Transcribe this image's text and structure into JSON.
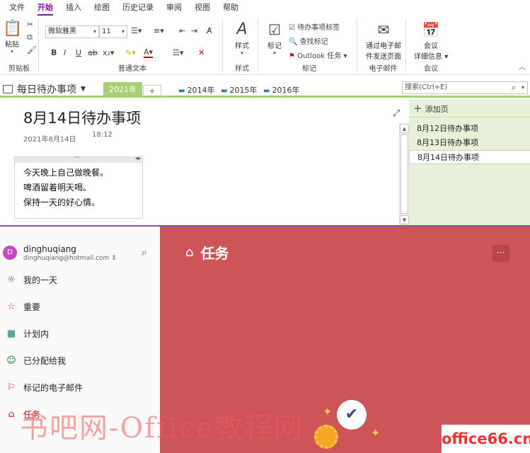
{
  "menu": [
    "文件",
    "开始",
    "插入",
    "绘图",
    "历史记录",
    "审阅",
    "视图",
    "帮助"
  ],
  "menu_active": "开始",
  "ribbon": {
    "clipboard": {
      "paste": "粘贴",
      "label": "剪贴板"
    },
    "text": {
      "font": "微软雅黑",
      "size": "11",
      "label": "普通文本"
    },
    "styles": {
      "button": "样式",
      "label": "样式"
    },
    "tags": {
      "tag": "标记",
      "todo_tag": "待办事项标签",
      "find_tags": "查找标记",
      "outlook_tasks": "Outlook 任务",
      "label": "标记"
    },
    "email": {
      "button_line1": "通过电子邮",
      "button_line2": "件发送页面",
      "label": "电子邮件"
    },
    "meetings": {
      "button_line1": "会议",
      "button_line2": "详细信息",
      "label": "会议"
    }
  },
  "notebook": {
    "name": "每日待办事项",
    "sections": [
      "2021年",
      "2014年",
      "2015年",
      "2016年"
    ],
    "active_section": "2021年",
    "add_section": "+",
    "search_placeholder": "搜索(Ctrl+E)"
  },
  "page": {
    "title": "8月14日待办事项",
    "date": "2021年8月14日",
    "time": "18:12",
    "lines": [
      "今天晚上自己做晚餐。",
      "啤酒留着明天喝。",
      "保持一天的好心情。"
    ]
  },
  "pagelist": {
    "add": "添加页",
    "pages": [
      "8月12日待办事项",
      "8月13日待办事项",
      "8月14日待办事项"
    ],
    "active_index": 2
  },
  "todo": {
    "user": {
      "initial": "D",
      "name": "dinghuqiang",
      "email": "dinghuqiang@hotmail.com"
    },
    "nav": [
      {
        "label": "我的一天",
        "icon": "sun-icon"
      },
      {
        "label": "重要",
        "icon": "star-icon"
      },
      {
        "label": "计划内",
        "icon": "calendar-icon"
      },
      {
        "label": "已分配给我",
        "icon": "person-icon"
      },
      {
        "label": "标记的电子邮件",
        "icon": "flag-icon"
      },
      {
        "label": "任务",
        "icon": "home-icon"
      }
    ],
    "active_nav": "任务",
    "main_title": "任务",
    "more": "···",
    "accent": "#cd5457"
  },
  "watermark": {
    "text": "书吧网-Office教程网",
    "logo": "office66.cn"
  },
  "colors": {
    "onenote_purple": "#7719aa",
    "section_green": "#a6ce72",
    "pagelist_bg": "#e7f1d9"
  }
}
